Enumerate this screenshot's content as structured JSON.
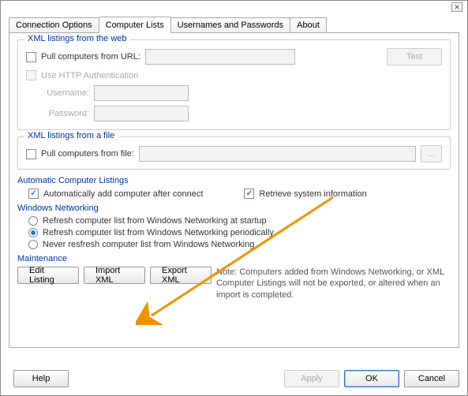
{
  "window": {
    "close_icon": "close"
  },
  "tabs": {
    "connection_options": "Connection Options",
    "computer_lists": "Computer Lists",
    "usernames_passwords": "Usernames and Passwords",
    "about": "About"
  },
  "xml_web": {
    "title": "XML listings from the web",
    "pull_url_label": "Pull computers from URL:",
    "pull_url_checked": false,
    "test_label": "Test",
    "use_http_auth_label": "Use HTTP Authentication",
    "use_http_auth_checked": false,
    "username_label": "Username:",
    "password_label": "Password:",
    "username_value": "",
    "password_value": "",
    "url_value": ""
  },
  "xml_file": {
    "title": "XML listings from a file",
    "pull_file_label": "Pull computers from file:",
    "pull_file_checked": false,
    "file_value": "",
    "browse_label": "..."
  },
  "auto": {
    "title": "Automatic Computer Listings",
    "auto_add_label": "Automatically add computer after connect",
    "auto_add_checked": true,
    "retrieve_label": "Retrieve system information",
    "retrieve_checked": true
  },
  "winnet": {
    "title": "Windows Networking",
    "opt_startup": "Refresh computer list from Windows Networking at startup",
    "opt_periodic": "Refresh computer list from Windows Networking periodically",
    "opt_never": "Never resfresh computer list from Windows Networking",
    "selected": "periodic"
  },
  "maintenance": {
    "title": "Maintenance",
    "edit_listing": "Edit Listing",
    "import_xml": "Import XML",
    "export_xml": "Export XML",
    "note": "Note: Computers added from Windows Networking, or XML Computer Listings will not be exported, or altered when an import is completed."
  },
  "footer": {
    "help": "Help",
    "apply": "Apply",
    "ok": "OK",
    "cancel": "Cancel"
  }
}
